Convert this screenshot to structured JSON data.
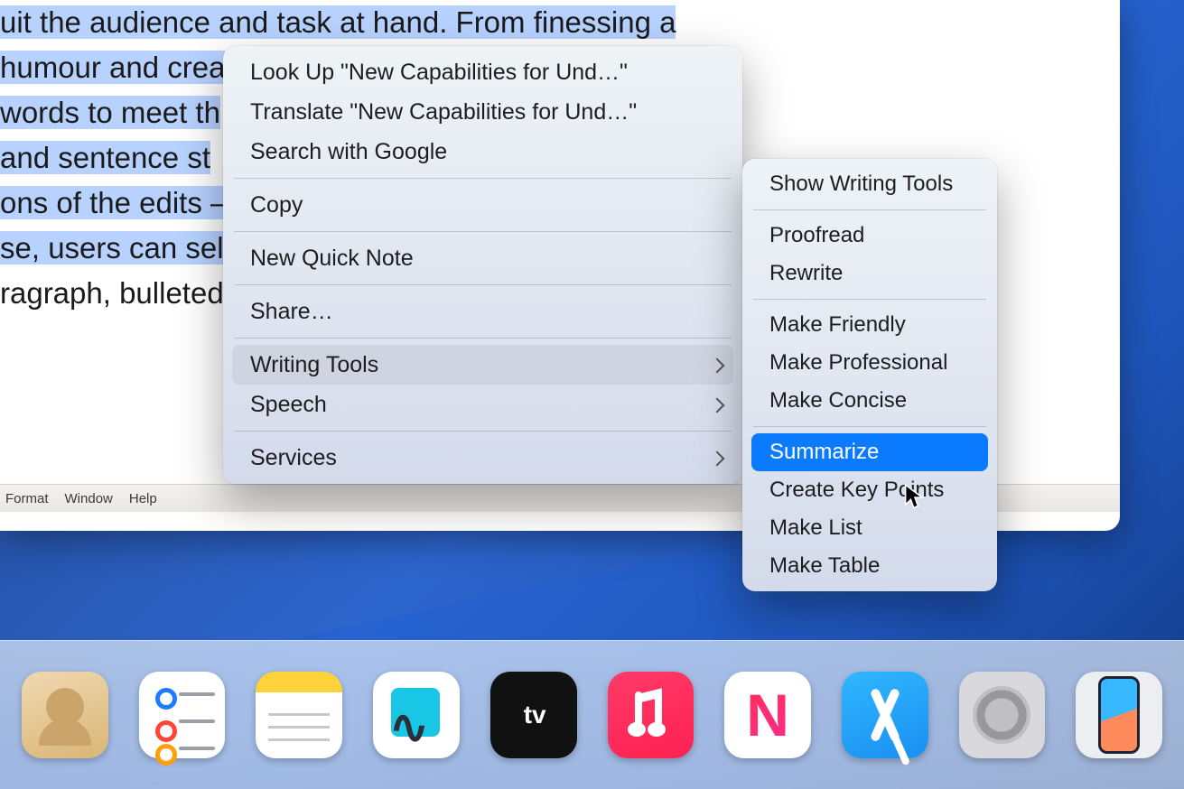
{
  "document": {
    "line1_pre": "uit the audience and task at hand. From finessing a",
    "line2_pre": "humour and crea",
    "line3_pre": "words to meet th",
    "line4_pre": " and sentence st",
    "line5_pre": "ons of the edits –",
    "line6_prefix": "se, users can sel",
    "line7_unselected": "ragraph, bulleted"
  },
  "menubar": {
    "items": [
      "Format",
      "Window",
      "Help"
    ]
  },
  "context_menu": {
    "items": [
      {
        "label": "Look Up \"New Capabilities for Und…\"",
        "submenu": false
      },
      {
        "label": "Translate \"New Capabilities for Und…\"",
        "submenu": false
      },
      {
        "label": "Search with Google",
        "submenu": false
      },
      {
        "separator": true
      },
      {
        "label": "Copy",
        "submenu": false
      },
      {
        "separator": true
      },
      {
        "label": "New Quick Note",
        "submenu": false
      },
      {
        "separator": true
      },
      {
        "label": "Share…",
        "submenu": false
      },
      {
        "separator": true
      },
      {
        "label": "Writing Tools",
        "submenu": true,
        "highlighted": true
      },
      {
        "label": "Speech",
        "submenu": true
      },
      {
        "separator": true
      },
      {
        "label": "Services",
        "submenu": true
      }
    ]
  },
  "writing_tools_submenu": {
    "items": [
      {
        "label": "Show Writing Tools"
      },
      {
        "separator": true
      },
      {
        "label": "Proofread"
      },
      {
        "label": "Rewrite"
      },
      {
        "separator": true
      },
      {
        "label": "Make Friendly"
      },
      {
        "label": "Make Professional"
      },
      {
        "label": "Make Concise"
      },
      {
        "separator": true
      },
      {
        "label": "Summarize",
        "selected": true
      },
      {
        "label": "Create Key Points"
      },
      {
        "label": "Make List"
      },
      {
        "label": "Make Table"
      }
    ]
  },
  "dock": {
    "apps": [
      {
        "name": "Contacts"
      },
      {
        "name": "Reminders"
      },
      {
        "name": "Notes"
      },
      {
        "name": "Freeform"
      },
      {
        "name": "TV"
      },
      {
        "name": "Music"
      },
      {
        "name": "News"
      },
      {
        "name": "App Store"
      },
      {
        "name": "System Settings"
      },
      {
        "name": "iPhone Mirroring"
      }
    ]
  }
}
